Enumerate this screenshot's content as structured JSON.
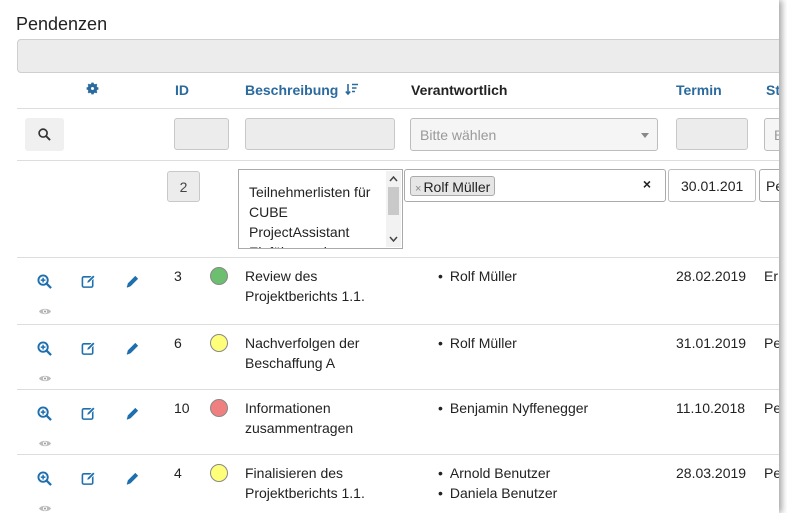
{
  "title": "Pendenzen",
  "columns": {
    "id": "ID",
    "description": "Beschreibung",
    "responsible": "Verantwortlich",
    "due": "Termin",
    "status": "St"
  },
  "filters": {
    "select_placeholder": "Bitte wählen",
    "status_placeholder": "B"
  },
  "edit_row": {
    "id": "2",
    "description": "Teilnehmerlisten für CUBE ProjectAssistant Einführungskurse",
    "responsible_tag": "Rolf Müller",
    "tag_remove": "×",
    "clear": "×",
    "due": "30.01.201",
    "status": "Pe"
  },
  "rows": [
    {
      "id": "3",
      "status_color": "#6cbf6f",
      "desc_line1": "Review des",
      "desc_line2": "Projektberichts 1.1.",
      "responsible": [
        "Rolf Müller"
      ],
      "due": "28.02.2019",
      "status": "Er"
    },
    {
      "id": "6",
      "status_color": "#ffff7a",
      "desc_line1": "Nachverfolgen der",
      "desc_line2": "Beschaffung A",
      "responsible": [
        "Rolf Müller"
      ],
      "due": "31.01.2019",
      "status": "Pe"
    },
    {
      "id": "10",
      "status_color": "#f08080",
      "desc_line1": "Informationen",
      "desc_line2": "zusammentragen",
      "responsible": [
        "Benjamin Nyffenegger"
      ],
      "due": "11.10.2018",
      "status": "Pe"
    },
    {
      "id": "4",
      "status_color": "#ffff7a",
      "desc_line1": "Finalisieren des",
      "desc_line2": "Projektberichts 1.1.",
      "responsible": [
        "Arnold Benutzer",
        "Daniela Benutzer"
      ],
      "due": "28.03.2019",
      "status": "Pe"
    }
  ],
  "colors": {
    "accent": "#2a6a9e",
    "icon": "#1f6fae",
    "eye": "#9a9a9a"
  }
}
